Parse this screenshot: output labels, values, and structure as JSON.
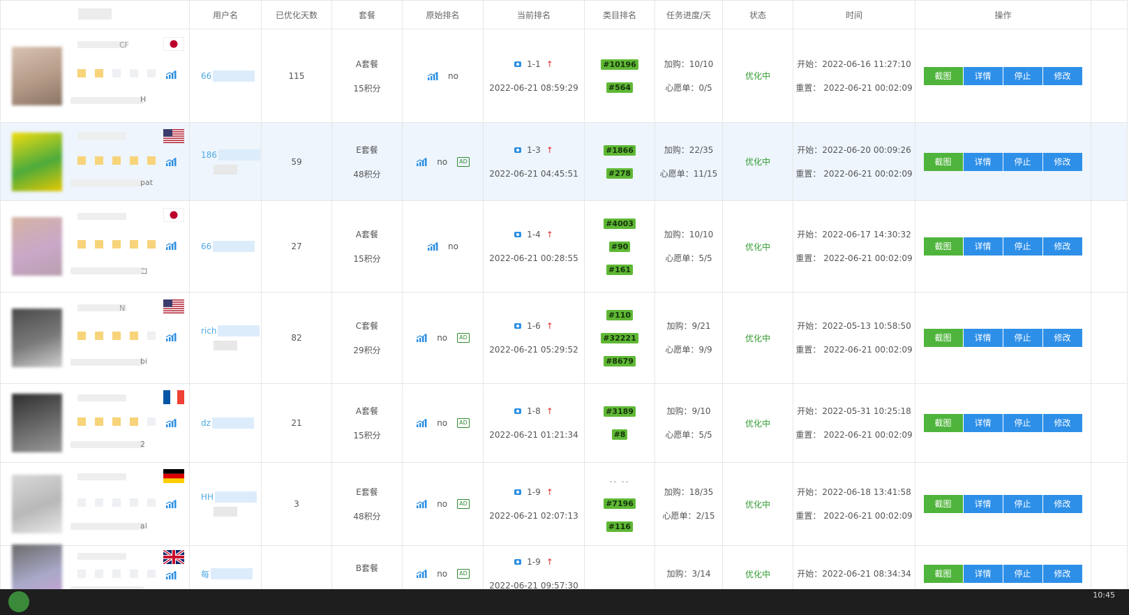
{
  "headers": {
    "username": "用户名",
    "days": "已优化天数",
    "package": "套餐",
    "original_rank": "原始排名",
    "current_rank": "当前排名",
    "category_rank": "类目排名",
    "task_progress": "任务进度/天",
    "status": "状态",
    "time": "时间",
    "actions": "操作"
  },
  "labels": {
    "cart": "加购：",
    "wishlist": "心愿单：",
    "start": "开始：",
    "reset": "重置："
  },
  "buttons": {
    "screenshot": "截图",
    "detail": "详情",
    "stop": "停止",
    "edit": "修改"
  },
  "rows": [
    {
      "title_frag": "CF",
      "title_frag2": "H",
      "flag": "jp",
      "user": "66",
      "days": "115",
      "pkg": "A套餐",
      "points": "15积分",
      "orig": "no",
      "ad": "",
      "rank": "1-1",
      "rank_time": "2022-06-21 08:59:29",
      "cat": [
        "#10196",
        "#564"
      ],
      "cart": "10/10",
      "wish": "0/5",
      "status": "优化中",
      "start": "2022-06-16 11:27:10",
      "reset": "2022-06-21 00:02:09",
      "stars": 2
    },
    {
      "title_frag": "",
      "title_frag2": "pat",
      "flag": "us",
      "user": "186",
      "days": "59",
      "pkg": "E套餐",
      "points": "48积分",
      "orig": "no",
      "ad": "AD",
      "rank": "1-3",
      "rank_time": "2022-06-21 04:45:51",
      "cat": [
        "#1866",
        "#278"
      ],
      "cart": "22/35",
      "wish": "11/15",
      "status": "优化中",
      "start": "2022-06-20 00:09:26",
      "reset": "2022-06-21 00:02:09",
      "stars": 5
    },
    {
      "title_frag": "",
      "title_frag2": "コ",
      "flag": "jp",
      "user": "66",
      "days": "27",
      "pkg": "A套餐",
      "points": "15积分",
      "orig": "no",
      "ad": "",
      "rank": "1-4",
      "rank_time": "2022-06-21 00:28:55",
      "cat": [
        "#4003",
        "#90",
        "#161"
      ],
      "cart": "10/10",
      "wish": "5/5",
      "status": "优化中",
      "start": "2022-06-17 14:30:32",
      "reset": "2022-06-21 00:02:09",
      "stars": 5
    },
    {
      "title_frag": "N",
      "title_frag2": "bi",
      "flag": "us",
      "user": "rich",
      "days": "82",
      "pkg": "C套餐",
      "points": "29积分",
      "orig": "no",
      "ad": "AD",
      "rank": "1-6",
      "rank_time": "2022-06-21 05:29:52",
      "cat": [
        "#110",
        "#32221",
        "#8679"
      ],
      "cart": "9/21",
      "wish": "9/9",
      "status": "优化中",
      "start": "2022-05-13 10:58:50",
      "reset": "2022-06-21 00:02:09",
      "stars": 4
    },
    {
      "title_frag": "",
      "title_frag2": "2",
      "flag": "fr",
      "user": "dz",
      "days": "21",
      "pkg": "A套餐",
      "points": "15积分",
      "orig": "no",
      "ad": "AD",
      "rank": "1-8",
      "rank_time": "2022-06-21 01:21:34",
      "cat": [
        "#3189",
        "#8"
      ],
      "cart": "9/10",
      "wish": "5/5",
      "status": "优化中",
      "start": "2022-05-31 10:25:18",
      "reset": "2022-06-21 00:02:09",
      "stars": 4
    },
    {
      "title_frag": "",
      "title_frag2": "al",
      "flag": "de",
      "user": "HH",
      "days": "3",
      "pkg": "E套餐",
      "points": "48积分",
      "orig": "no",
      "ad": "AD",
      "rank": "1-9",
      "rank_time": "2022-06-21 02:07:13",
      "cat_dash": "-- --",
      "cat": [
        "#7196",
        "#116"
      ],
      "cart": "18/35",
      "wish": "2/15",
      "status": "优化中",
      "start": "2022-06-18 13:41:58",
      "reset": "2022-06-21 00:02:09",
      "stars": 0
    },
    {
      "title_frag": "",
      "title_frag2": "",
      "flag": "gb",
      "user": "每",
      "days": "",
      "pkg": "B套餐",
      "points": "",
      "orig": "no",
      "ad": "AD",
      "rank": "1-9",
      "rank_time": "2022-06-21 09:57:30",
      "cat": [],
      "cart": "3/14",
      "wish": "",
      "status": "优化中",
      "start": "2022-06-21 08:34:34",
      "reset": "",
      "stars": 0
    }
  ],
  "taskbar": {
    "clock": "10:45"
  },
  "colors": {
    "tag_green": "#5fb835",
    "button_green": "#4fb43b",
    "button_blue": "#2d8fe8",
    "status_green": "#2f9a2f",
    "highlight_row": "#eef5fd"
  }
}
